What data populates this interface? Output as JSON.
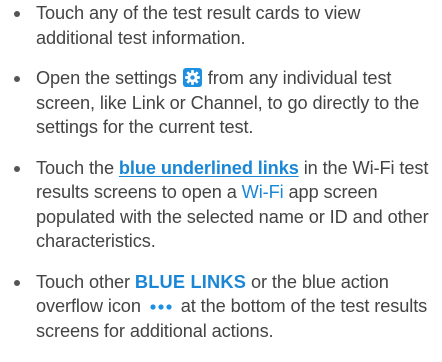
{
  "items": [
    {
      "text": "Touch any of the test result cards to view additional test information."
    },
    {
      "before": "Open the settings",
      "after": "from any individual test screen, like Link or Channel, to go directly to the settings for the current test.",
      "icon": "settings-gear-icon"
    },
    {
      "before": "Touch the",
      "link": "blue underlined links",
      "middle": "in the Wi-Fi test results screens to open a",
      "link2": "Wi-Fi",
      "after": "app screen populated with the selected name or ID and other characteristics."
    },
    {
      "before": "Touch other",
      "link": "BLUE LINKS",
      "middle": "or the blue action overflow icon",
      "after": "at the bottom of the test results screens for additional actions.",
      "icon": "more-actions-icon"
    }
  ],
  "colors": {
    "text": "#444444",
    "link": "#1a87d6",
    "icon_bg": "#1f8fe0"
  }
}
